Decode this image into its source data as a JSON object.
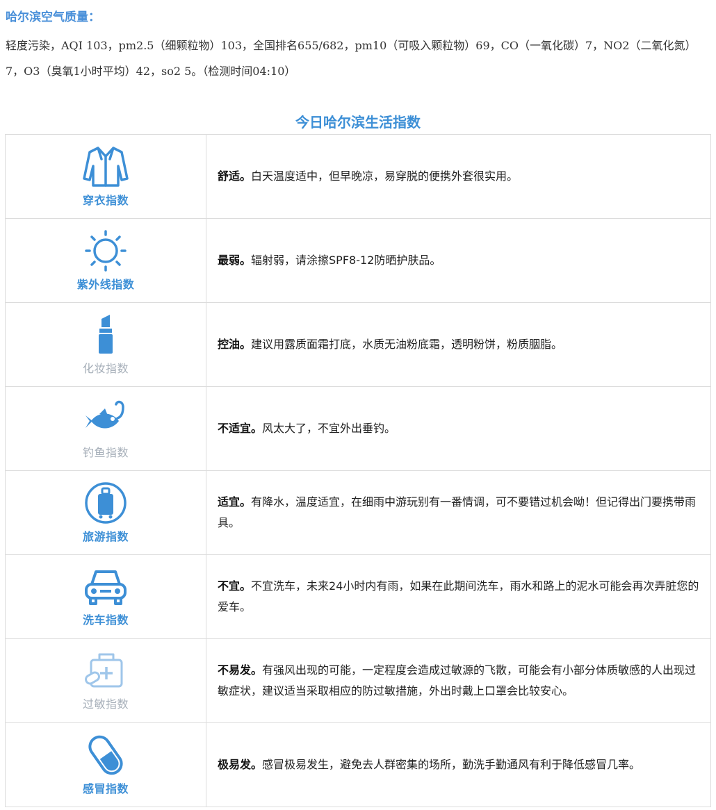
{
  "air_quality": {
    "title": "哈尔滨空气质量：",
    "text": "轻度污染，AQI 103，pm2.5（细颗粒物）103，全国排名655/682，pm10（可吸入颗粒物）69，CO（一氧化碳）7，NO2（二氧化氮）7，O3（臭氧1小时平均）42，so2 5。（检测时间04:10）"
  },
  "section_title": "今日哈尔滨生活指数",
  "indices": [
    {
      "label": "穿衣指数",
      "icon": "shirt-icon",
      "lead": "舒适。",
      "text": "白天温度适中，但早晚凉，易穿脱的便携外套很实用。"
    },
    {
      "label": "紫外线指数",
      "icon": "sun-icon",
      "lead": "最弱。",
      "text": "辐射弱，请涂擦SPF8-12防晒护肤品。"
    },
    {
      "label": "化妆指数",
      "icon": "lipstick-icon",
      "lead": "控油。",
      "text": "建议用露质面霜打底，水质无油粉底霜，透明粉饼，粉质胭脂。"
    },
    {
      "label": "钓鱼指数",
      "icon": "fish-hook-icon",
      "lead": "不适宜。",
      "text": "风太大了，不宜外出垂钓。"
    },
    {
      "label": "旅游指数",
      "icon": "luggage-icon",
      "lead": "适宜。",
      "text": "有降水，温度适宜，在细雨中游玩别有一番情调，可不要错过机会呦！但记得出门要携带雨具。"
    },
    {
      "label": "洗车指数",
      "icon": "car-icon",
      "lead": "不宜。",
      "text": "不宜洗车，未来24小时内有雨，如果在此期间洗车，雨水和路上的泥水可能会再次弄脏您的爱车。"
    },
    {
      "label": "过敏指数",
      "icon": "medical-kit-icon",
      "lead": "不易发。",
      "text": "有强风出现的可能，一定程度会造成过敏源的飞散，可能会有小部分体质敏感的人出现过敏症状，建议适当采取相应的防过敏措施，外出时戴上口罩会比较安心。"
    },
    {
      "label": "感冒指数",
      "icon": "pill-icon",
      "lead": "极易发。",
      "text": "感冒极易发生，避免去人群密集的场所，勤洗手勤通风有利于降低感冒几率。"
    }
  ],
  "colors": {
    "accent": "#3d8fd6",
    "label_gray": "#a5aeb8",
    "border": "#dcdcdc"
  }
}
